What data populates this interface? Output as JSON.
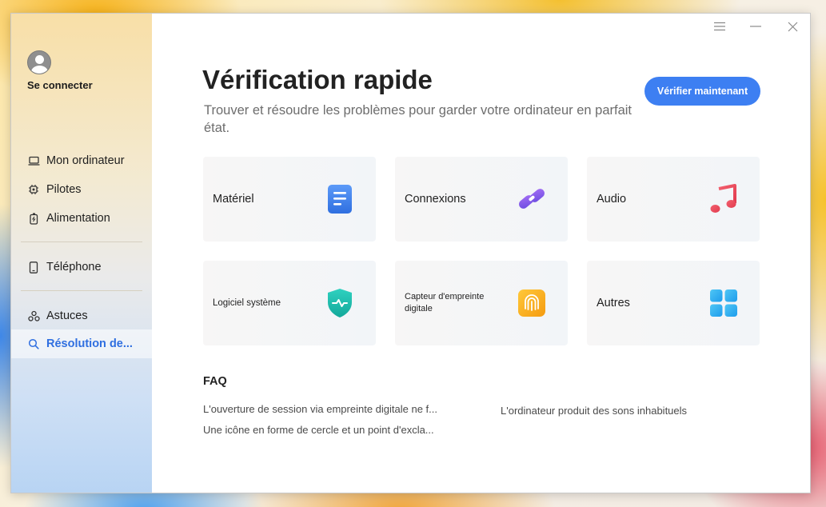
{
  "window": {
    "controls": {
      "menu": "menu-icon",
      "minimize": "minimize-icon",
      "close": "close-icon"
    }
  },
  "sidebar": {
    "signin_label": "Se connecter",
    "items": [
      {
        "label": "Mon ordinateur",
        "icon": "laptop-icon"
      },
      {
        "label": "Pilotes",
        "icon": "chip-icon"
      },
      {
        "label": "Alimentation",
        "icon": "battery-icon"
      },
      {
        "label": "Téléphone",
        "icon": "phone-icon"
      },
      {
        "label": "Astuces",
        "icon": "tips-icon"
      },
      {
        "label": "Résolution de...",
        "icon": "search-icon"
      }
    ]
  },
  "main": {
    "title": "Vérification rapide",
    "subtitle": "Trouver et résoudre les problèmes pour garder votre ordinateur en parfait état.",
    "verify_button": "Vérifier maintenant",
    "cards": [
      {
        "label": "Matériel",
        "icon": "document-icon"
      },
      {
        "label": "Connexions",
        "icon": "link-icon"
      },
      {
        "label": "Audio",
        "icon": "music-note-icon"
      },
      {
        "label": "Logiciel système",
        "icon": "shield-pulse-icon"
      },
      {
        "label": "Capteur d'empreinte digitale",
        "icon": "fingerprint-icon"
      },
      {
        "label": "Autres",
        "icon": "grid-icon"
      }
    ],
    "faq": {
      "title": "FAQ",
      "items": [
        "L'ouverture de session via empreinte digitale ne f...",
        "Une icône en forme de cercle et un point d'excla...",
        "L'ordinateur produit des sons inhabituels"
      ]
    }
  },
  "colors": {
    "accent": "#3d7ff2",
    "active_nav_text": "#2f6fe0"
  }
}
